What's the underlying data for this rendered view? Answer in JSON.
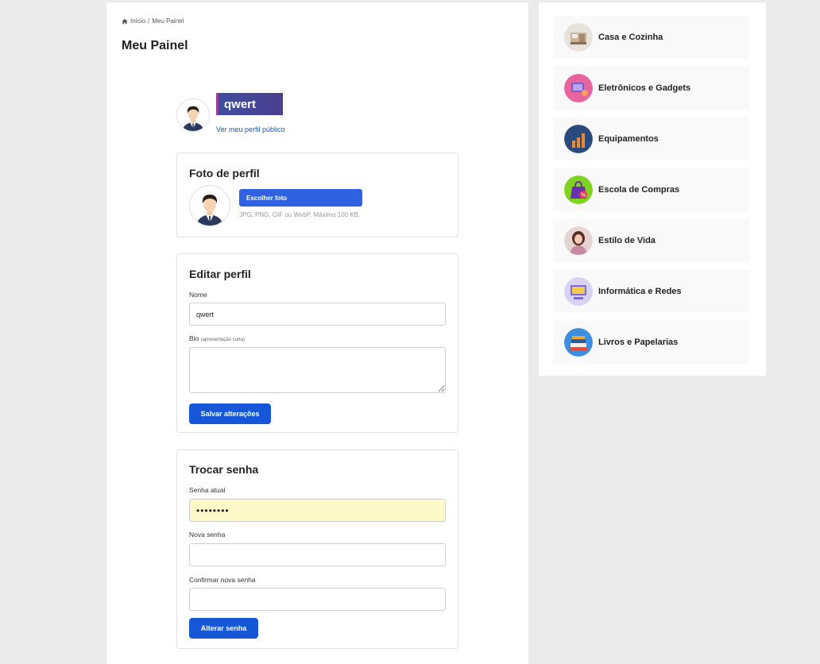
{
  "breadcrumb": {
    "home": "Início",
    "separator": "/",
    "current": "Meu Painel"
  },
  "page_title": "Meu Painel",
  "profile": {
    "username": "qwert",
    "public_link": "Ver meu perfil público"
  },
  "photo_card": {
    "title": "Foto de perfil",
    "choose_button": "Escolher foto",
    "hint": "JPG, PNG, GIF ou WebP. Máximo 100 KB."
  },
  "edit_card": {
    "title": "Editar perfil",
    "name_label": "Nome",
    "name_value": "qwert",
    "bio_label": "Bio",
    "bio_hint": "(apresentação curta)",
    "bio_value": "",
    "save_button": "Salvar alterações"
  },
  "password_card": {
    "title": "Trocar senha",
    "current_label": "Senha atual",
    "current_value": "••••••••",
    "new_label": "Nova senha",
    "new_value": "",
    "confirm_label": "Confirmar nova senha",
    "confirm_value": "",
    "change_button": "Alterar senha"
  },
  "categories": [
    {
      "label": "Casa e Cozinha",
      "icon": "house-kitchen-icon"
    },
    {
      "label": "Eletrônicos e Gadgets",
      "icon": "gadgets-icon"
    },
    {
      "label": "Equipamentos",
      "icon": "equipment-chart-icon"
    },
    {
      "label": "Escola de Compras",
      "icon": "shopping-bag-percent-icon"
    },
    {
      "label": "Estilo de Vida",
      "icon": "lifestyle-woman-icon"
    },
    {
      "label": "Informática e Redes",
      "icon": "computer-icon"
    },
    {
      "label": "Livros e Papelarias",
      "icon": "books-icon"
    }
  ],
  "colors": {
    "primary_button": "#1557d6",
    "choose_button": "#2f62e0",
    "link": "#1a56b0",
    "autofill_bg": "#fdf9c8",
    "page_bg": "#ebebeb"
  }
}
